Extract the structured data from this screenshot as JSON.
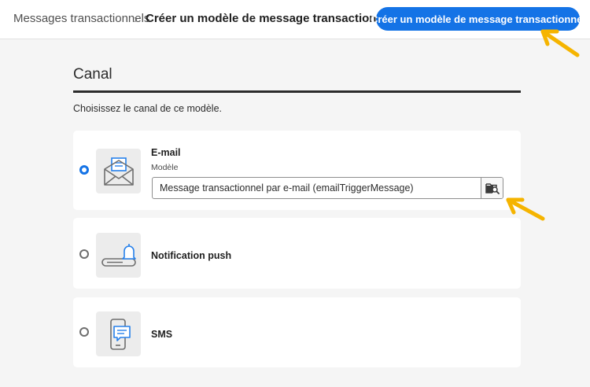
{
  "header": {
    "breadcrumb_parent": "Messages transactionnels",
    "breadcrumb_separator": "›",
    "breadcrumb_current": "Créer un modèle de message transactionnel",
    "primary_button": "Créer un modèle de message transactionnel"
  },
  "section": {
    "title": "Canal",
    "hint": "Choisissez le canal de ce modèle."
  },
  "channels": [
    {
      "label": "E-mail",
      "selected": true,
      "icon": "email-envelope-icon",
      "field_label": "Modèle",
      "field_value": "Message transactionnel par e-mail (emailTriggerMessage)",
      "field_button_icon": "folder-search-icon"
    },
    {
      "label": "Notification push",
      "selected": false,
      "icon": "push-bell-icon"
    },
    {
      "label": "SMS",
      "selected": false,
      "icon": "sms-phone-icon"
    }
  ],
  "colors": {
    "accent": "#1473e6",
    "annotation_arrow": "#f5b400",
    "icon_blue": "#2680eb"
  }
}
